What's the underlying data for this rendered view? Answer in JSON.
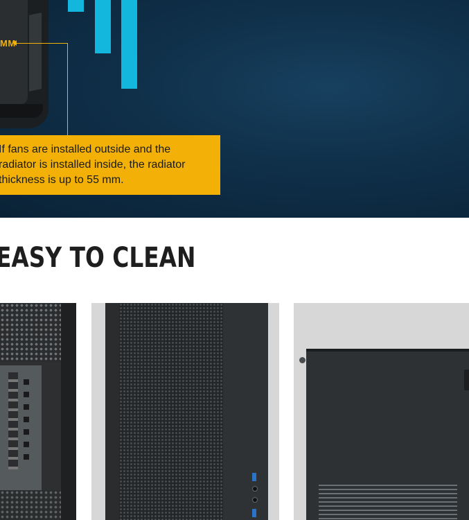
{
  "banner": {
    "measure_label": "MM",
    "note_lines": [
      "If fans are installed outside and the",
      "radiator is installed inside, the radiator",
      "thickness is up to 55 mm."
    ],
    "colors": {
      "background": "#0f2f48",
      "accent_bars": "#13b6dc",
      "note_bg": "#f3b107"
    }
  },
  "section": {
    "heading": "EASY TO CLEAN"
  },
  "panels": [
    {
      "name": "case-interior-side"
    },
    {
      "name": "case-front-mesh"
    },
    {
      "name": "case-side-panel"
    }
  ]
}
